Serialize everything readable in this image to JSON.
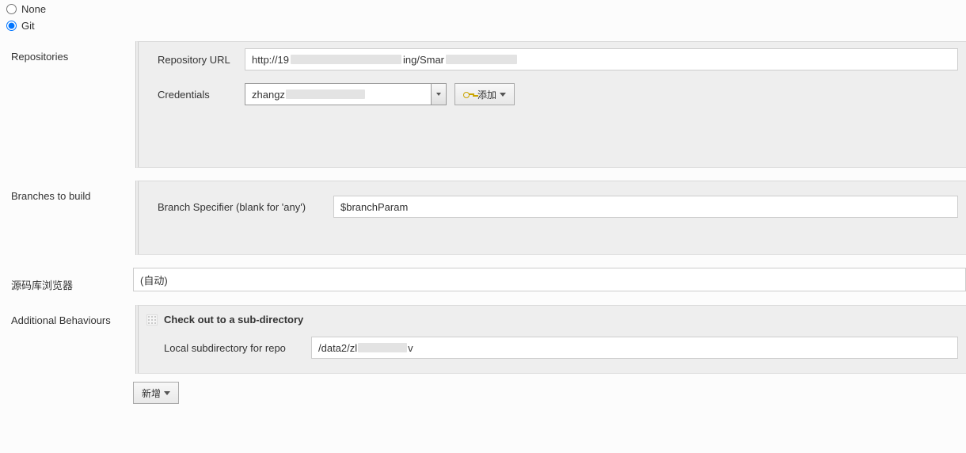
{
  "scm": {
    "options": {
      "none": "None",
      "git": "Git"
    },
    "selected": "git"
  },
  "sections": {
    "repositories": "Repositories",
    "branches": "Branches to build",
    "browser": "源码库浏览器",
    "additional": "Additional Behaviours"
  },
  "repositories": {
    "url_label": "Repository URL",
    "url_prefix": "http://19",
    "url_mid": "ing/Smar",
    "credentials_label": "Credentials",
    "credentials_prefix": "zhangz",
    "add_button": "添加"
  },
  "branches": {
    "specifier_label": "Branch Specifier (blank for 'any')",
    "specifier_value": "$branchParam"
  },
  "browser": {
    "value": "(自动)"
  },
  "behaviours": {
    "checkout_sub": "Check out to a sub-directory",
    "local_subdir_label": "Local subdirectory for repo",
    "local_subdir_prefix": "/data2/zl",
    "local_subdir_suffix": "v",
    "add_new": "新增"
  }
}
